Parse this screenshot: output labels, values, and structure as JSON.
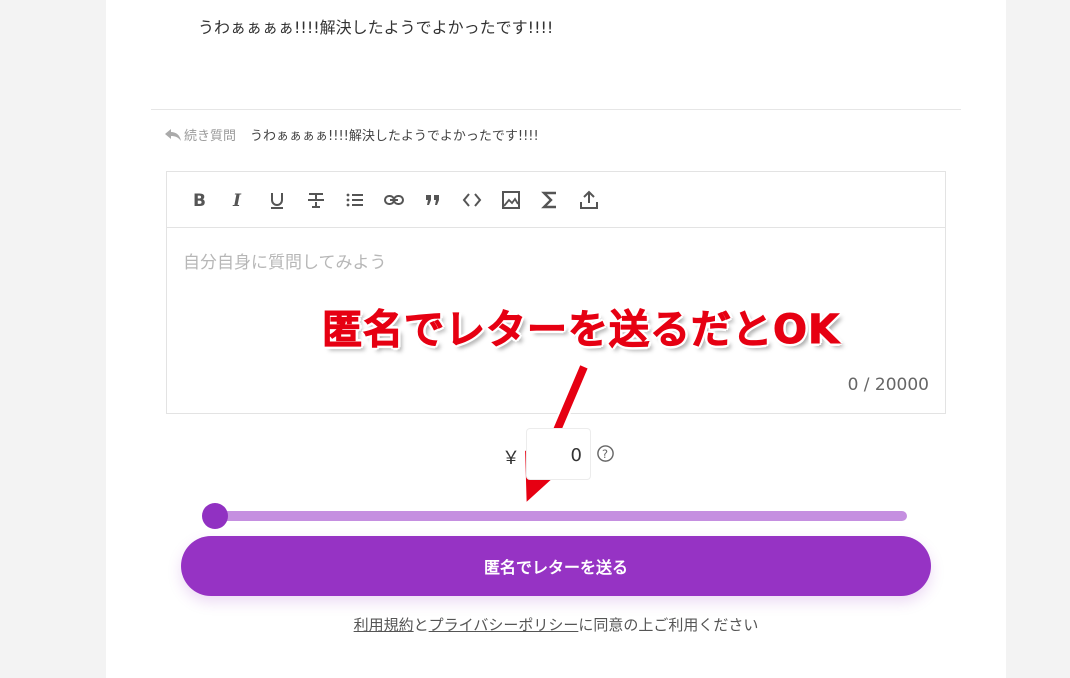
{
  "previous_message": "うわぁぁぁぁ!!!!解決したようでよかったです!!!!",
  "reply": {
    "label": "続き質問",
    "quote": "うわぁぁぁぁ!!!!解決したようでよかったです!!!!"
  },
  "editor": {
    "toolbar": [
      "bold-icon",
      "italic-icon",
      "underline-icon",
      "strikethrough-icon",
      "bullet-list-icon",
      "link-icon",
      "quote-icon",
      "code-icon",
      "image-icon",
      "sigma-icon",
      "upload-icon"
    ],
    "placeholder": "自分自身に質問してみよう",
    "counter": "0 / 20000"
  },
  "annotation": "匿名でレターを送るだとOK",
  "price": {
    "currency": "￥",
    "amount": "0"
  },
  "slider": {
    "value_fraction": 0.0
  },
  "send_button": "匿名でレターを送る",
  "terms": {
    "link1": "利用規約",
    "conj": "と",
    "link2": "プライバシーポリシー",
    "suffix": "に同意の上ご利用ください"
  },
  "colors": {
    "accent": "#9633c4",
    "slider_track": "#c58fe0",
    "annotation": "#e60012"
  }
}
